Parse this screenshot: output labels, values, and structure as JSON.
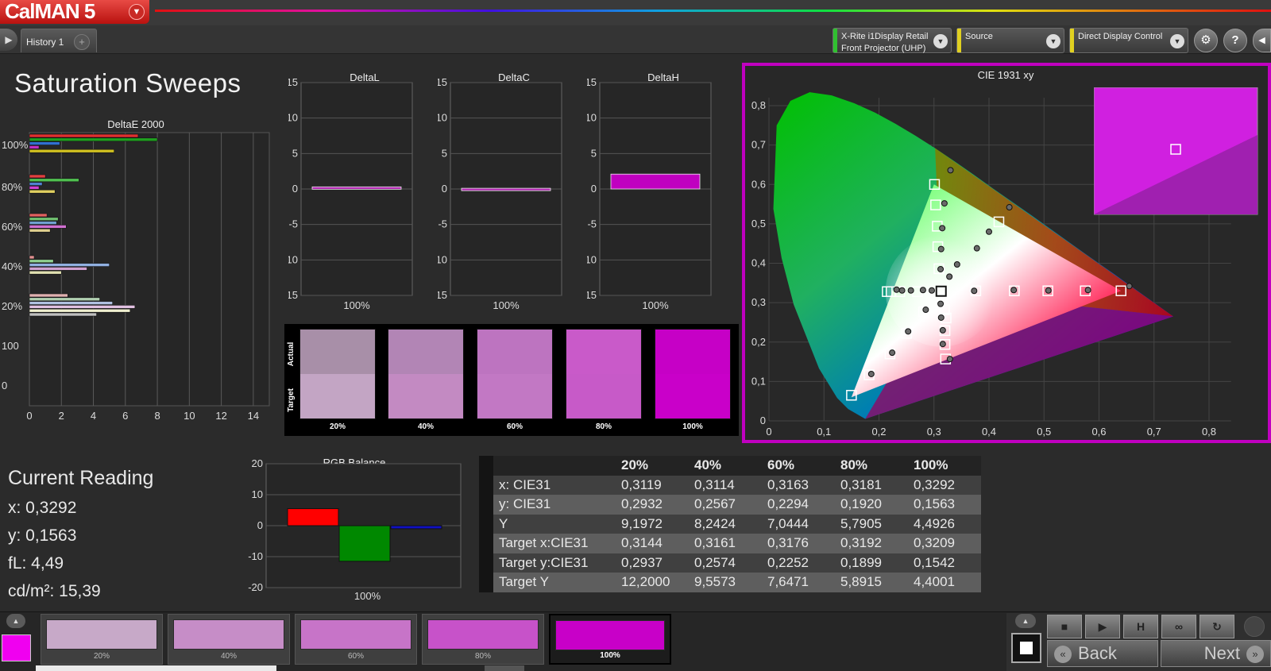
{
  "app": {
    "name": "CalMAN 5"
  },
  "tabs": [
    {
      "label": "History 1"
    }
  ],
  "devices": {
    "meter": {
      "line1": "X-Rite i1Display Retail",
      "line2": "Front Projector (UHP)",
      "stripe": "#30c030"
    },
    "source": {
      "line1": "Source",
      "stripe": "#e0d020"
    },
    "display": {
      "line1": "Direct Display Control",
      "stripe": "#e0d020"
    }
  },
  "page_title": "Saturation Sweeps",
  "accent_color": "#c000c0",
  "charts": [
    {
      "id": "deltae2000",
      "type": "bar",
      "title": "DeltaE 2000",
      "xticks": [
        "0",
        "2",
        "4",
        "6",
        "8",
        "10",
        "12",
        "14"
      ],
      "ylabels": [
        "100%",
        "80%",
        "60%",
        "40%",
        "20%",
        "100",
        "0"
      ],
      "xlim": [
        0,
        15
      ]
    },
    {
      "id": "deltaL",
      "type": "bar",
      "title": "DeltaL",
      "categories": [
        "100%"
      ],
      "values": [
        0.3
      ],
      "ylim": [
        -15,
        15
      ],
      "yticks": [
        "15",
        "10",
        "5",
        "0",
        "-5",
        "-10",
        "-15"
      ]
    },
    {
      "id": "deltaC",
      "type": "bar",
      "title": "DeltaC",
      "categories": [
        "100%"
      ],
      "values": [
        0.1
      ],
      "ylim": [
        -15,
        15
      ],
      "yticks": [
        "15",
        "10",
        "5",
        "0",
        "-5",
        "-10",
        "-15"
      ]
    },
    {
      "id": "deltaH",
      "type": "bar",
      "title": "DeltaH",
      "categories": [
        "100%"
      ],
      "values": [
        2.1
      ],
      "ylim": [
        -15,
        15
      ],
      "yticks": [
        "15",
        "10",
        "5",
        "0",
        "-5",
        "-10",
        "-15"
      ]
    },
    {
      "id": "rgb",
      "type": "bar",
      "title": "RGB Balance",
      "categories": [
        "100%"
      ],
      "ylim": [
        -20,
        20
      ],
      "yticks": [
        "20",
        "10",
        "0",
        "-10",
        "-20"
      ],
      "series": [
        {
          "color": "#ff0000",
          "values": [
            5.5
          ]
        },
        {
          "color": "#008800",
          "values": [
            -11.5
          ]
        },
        {
          "color": "#1010c0",
          "values": [
            -1
          ]
        }
      ]
    },
    {
      "id": "cie",
      "type": "scatter",
      "title": "CIE 1931 xy",
      "xticks": [
        "0",
        "0,1",
        "0,2",
        "0,3",
        "0,4",
        "0,5",
        "0,6",
        "0,7",
        "0,8"
      ],
      "yticks": [
        "0",
        "0,1",
        "0,2",
        "0,3",
        "0,4",
        "0,5",
        "0,6",
        "0,7",
        "0,8"
      ],
      "xlim": [
        0,
        0.85
      ],
      "ylim": [
        0,
        0.85
      ],
      "gamut": [
        [
          0.64,
          0.33
        ],
        [
          0.3,
          0.6
        ],
        [
          0.15,
          0.06
        ]
      ],
      "targets": [
        [
          0.313,
          0.329
        ],
        [
          0.301,
          0.6
        ],
        [
          0.303,
          0.548
        ],
        [
          0.306,
          0.494
        ],
        [
          0.307,
          0.442
        ],
        [
          0.309,
          0.386
        ],
        [
          0.418,
          0.505
        ],
        [
          0.376,
          0.33
        ],
        [
          0.446,
          0.33
        ],
        [
          0.507,
          0.33
        ],
        [
          0.575,
          0.33
        ],
        [
          0.64,
          0.33
        ],
        [
          0.27,
          0.328
        ],
        [
          0.238,
          0.328
        ],
        [
          0.222,
          0.328
        ],
        [
          0.215,
          0.328
        ],
        [
          0.281,
          0.277
        ],
        [
          0.25,
          0.222
        ],
        [
          0.22,
          0.17
        ],
        [
          0.182,
          0.117
        ],
        [
          0.15,
          0.065
        ],
        [
          0.319,
          0.282
        ],
        [
          0.322,
          0.261
        ],
        [
          0.32,
          0.229
        ],
        [
          0.32,
          0.194
        ],
        [
          0.321,
          0.157
        ]
      ],
      "measured": [
        [
          0.33,
          0.636
        ],
        [
          0.319,
          0.552
        ],
        [
          0.315,
          0.489
        ],
        [
          0.313,
          0.436
        ],
        [
          0.312,
          0.385
        ],
        [
          0.328,
          0.366
        ],
        [
          0.342,
          0.397
        ],
        [
          0.378,
          0.438
        ],
        [
          0.4,
          0.48
        ],
        [
          0.437,
          0.542
        ],
        [
          0.373,
          0.33
        ],
        [
          0.445,
          0.332
        ],
        [
          0.508,
          0.331
        ],
        [
          0.58,
          0.332
        ],
        [
          0.655,
          0.342
        ],
        [
          0.232,
          0.333
        ],
        [
          0.242,
          0.331
        ],
        [
          0.258,
          0.331
        ],
        [
          0.28,
          0.332
        ],
        [
          0.296,
          0.331
        ],
        [
          0.312,
          0.297
        ],
        [
          0.313,
          0.262
        ],
        [
          0.316,
          0.23
        ],
        [
          0.316,
          0.195
        ],
        [
          0.329,
          0.157
        ],
        [
          0.285,
          0.282
        ],
        [
          0.253,
          0.227
        ],
        [
          0.224,
          0.173
        ],
        [
          0.186,
          0.119
        ]
      ],
      "inset_target": [
        0.64,
        0.33
      ],
      "inset_measured": [
        0.656,
        0.334
      ]
    }
  ],
  "swatches": {
    "labels": [
      "20%",
      "40%",
      "60%",
      "80%",
      "100%"
    ],
    "actual": [
      "#a88fa8",
      "#b285b5",
      "#bd74c0",
      "#c95ac9",
      "#c600c6"
    ],
    "target": [
      "#c3a5c4",
      "#c38ac2",
      "#c278c4",
      "#c75ac8",
      "#c900c9"
    ],
    "side_actual": "Actual",
    "side_target": "Target"
  },
  "current_reading": {
    "title": "Current Reading",
    "x": "x: 0,3292",
    "y": "y: 0,1563",
    "fL": "fL: 4,49",
    "cd": "cd/m²: 15,39"
  },
  "table": {
    "headers": [
      "",
      "20%",
      "40%",
      "60%",
      "80%",
      "100%"
    ],
    "rows": [
      {
        "name": "x: CIE31",
        "v": [
          "0,3119",
          "0,3114",
          "0,3163",
          "0,3181",
          "0,3292"
        ]
      },
      {
        "name": "y: CIE31",
        "v": [
          "0,2932",
          "0,2567",
          "0,2294",
          "0,1920",
          "0,1563"
        ]
      },
      {
        "name": "Y",
        "v": [
          "9,1972",
          "8,2424",
          "7,0444",
          "5,7905",
          "4,4926"
        ]
      },
      {
        "name": "Target x:CIE31",
        "v": [
          "0,3144",
          "0,3161",
          "0,3176",
          "0,3192",
          "0,3209"
        ]
      },
      {
        "name": "Target y:CIE31",
        "v": [
          "0,2937",
          "0,2574",
          "0,2252",
          "0,1899",
          "0,1542"
        ]
      },
      {
        "name": "Target Y",
        "v": [
          "12,2000",
          "9,5573",
          "7,6471",
          "5,8915",
          "4,4001"
        ]
      }
    ]
  },
  "strip": [
    {
      "label": "20%",
      "color": "#c7a9c8"
    },
    {
      "label": "40%",
      "color": "#c68dc7"
    },
    {
      "label": "60%",
      "color": "#c774c8"
    },
    {
      "label": "80%",
      "color": "#c752c9"
    },
    {
      "label": "100%",
      "color": "#c800c8"
    }
  ],
  "nav": {
    "back": "Back",
    "next": "Next"
  },
  "icons": {
    "nav_toggle": "play-icon",
    "settings": "gear-icon",
    "help": "question-icon",
    "stop": "stop-icon",
    "play": "play-icon",
    "hold": "h-icon",
    "loop": "infinity-icon",
    "refresh": "refresh-icon"
  }
}
